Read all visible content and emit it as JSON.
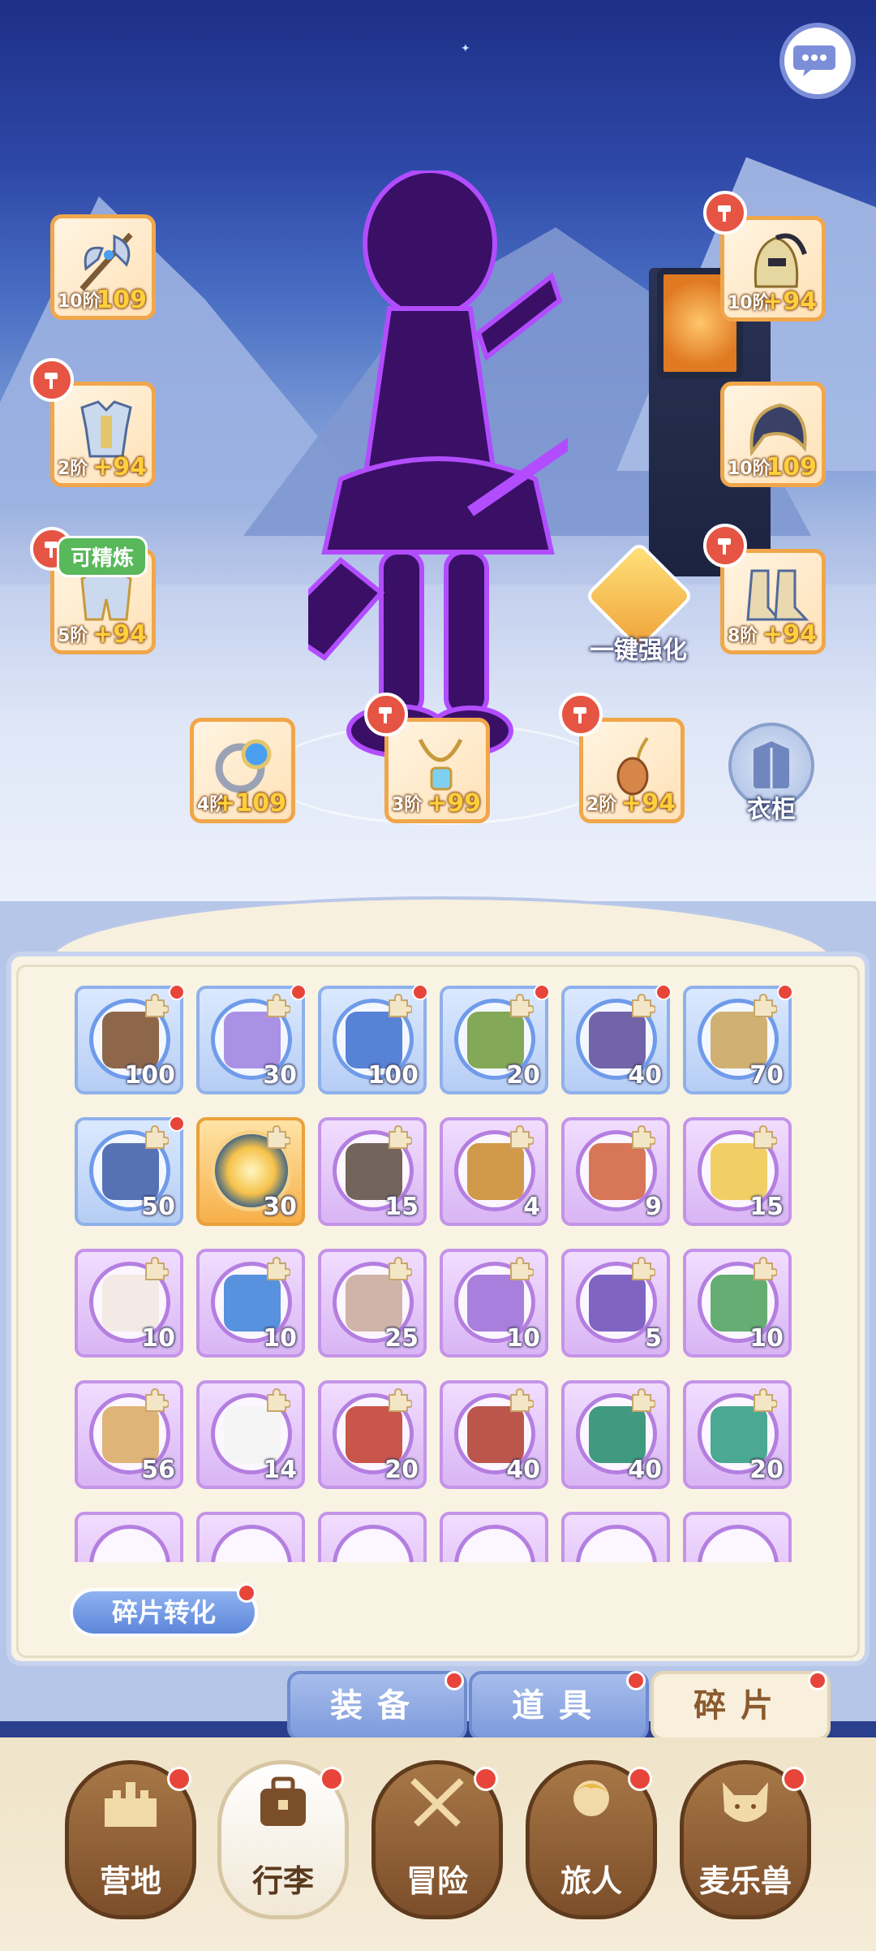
{
  "header": {
    "chat_icon": "chat-bubble-icon"
  },
  "equipment": [
    {
      "id": "weapon",
      "tier": "10阶",
      "bonus": "109",
      "icon": "axe-icon"
    },
    {
      "id": "helmet",
      "tier": "10阶",
      "bonus": "+94",
      "icon": "helmet-icon"
    },
    {
      "id": "chest",
      "tier": "2阶",
      "bonus": "+94",
      "icon": "armor-icon"
    },
    {
      "id": "hood",
      "tier": "10阶",
      "bonus": "109",
      "icon": "hood-icon"
    },
    {
      "id": "legs",
      "tier": "5阶",
      "bonus": "+94",
      "icon": "leg-armor-icon"
    },
    {
      "id": "boots",
      "tier": "8阶",
      "bonus": "+94",
      "icon": "boots-icon"
    },
    {
      "id": "ring",
      "tier": "4阶",
      "bonus": "+109",
      "icon": "ring-icon"
    },
    {
      "id": "necklace",
      "tier": "3阶",
      "bonus": "+99",
      "icon": "necklace-icon"
    },
    {
      "id": "charm",
      "tier": "2阶",
      "bonus": "+94",
      "icon": "charm-icon"
    }
  ],
  "refine_tag": "可精炼",
  "enhance_label": "一键强化",
  "wardrobe_label": "衣柜",
  "fragments": [
    {
      "color": "blue",
      "count": "100",
      "icon": "lantern-icon"
    },
    {
      "color": "blue",
      "count": "30",
      "icon": "harp-icon"
    },
    {
      "color": "blue",
      "count": "100",
      "icon": "orb-icon"
    },
    {
      "color": "blue",
      "count": "20",
      "icon": "spellbook-icon"
    },
    {
      "color": "blue",
      "count": "40",
      "icon": "book-icon"
    },
    {
      "color": "blue",
      "count": "70",
      "icon": "dagger-icon"
    },
    {
      "color": "blue",
      "count": "50",
      "icon": "scroll-icon"
    },
    {
      "color": "orange",
      "count": "30",
      "icon": "burst-icon"
    },
    {
      "color": "purple",
      "count": "15",
      "icon": "sheep-icon"
    },
    {
      "color": "purple",
      "count": "4",
      "icon": "beast-icon"
    },
    {
      "color": "purple",
      "count": "9",
      "icon": "fox-icon"
    },
    {
      "color": "purple",
      "count": "15",
      "icon": "chick-icon"
    },
    {
      "color": "purple",
      "count": "10",
      "icon": "cat-icon"
    },
    {
      "color": "purple",
      "count": "10",
      "icon": "fish-icon"
    },
    {
      "color": "purple",
      "count": "25",
      "icon": "pig-icon"
    },
    {
      "color": "purple",
      "count": "10",
      "icon": "purple-cat-icon"
    },
    {
      "color": "purple",
      "count": "5",
      "icon": "purple-beast-icon"
    },
    {
      "color": "purple",
      "count": "10",
      "icon": "snake-icon"
    },
    {
      "color": "purple",
      "count": "56",
      "icon": "dog-icon"
    },
    {
      "color": "purple",
      "count": "14",
      "icon": "bear-icon"
    },
    {
      "color": "purple",
      "count": "20",
      "icon": "fire-skill-icon"
    },
    {
      "color": "purple",
      "count": "40",
      "icon": "slash-skill-icon"
    },
    {
      "color": "purple",
      "count": "40",
      "icon": "heal-skill-icon"
    },
    {
      "color": "purple",
      "count": "20",
      "icon": "hand-skill-icon"
    }
  ],
  "convert_label": "碎片转化",
  "category_tabs": [
    {
      "label": "装备",
      "active": false
    },
    {
      "label": "道具",
      "active": false
    },
    {
      "label": "碎片",
      "active": true
    }
  ],
  "bottom_nav": [
    {
      "label": "营地",
      "icon": "castle-icon",
      "active": false
    },
    {
      "label": "行李",
      "icon": "bag-icon",
      "active": true
    },
    {
      "label": "冒险",
      "icon": "crossed-swords-icon",
      "active": false
    },
    {
      "label": "旅人",
      "icon": "traveler-icon",
      "active": false
    },
    {
      "label": "麦乐兽",
      "icon": "pet-icon",
      "active": false
    }
  ],
  "colors": {
    "accent_red": "#e8453a",
    "tier_gold": "#ffcf3c",
    "tab_blue": "#7c9bdc"
  }
}
